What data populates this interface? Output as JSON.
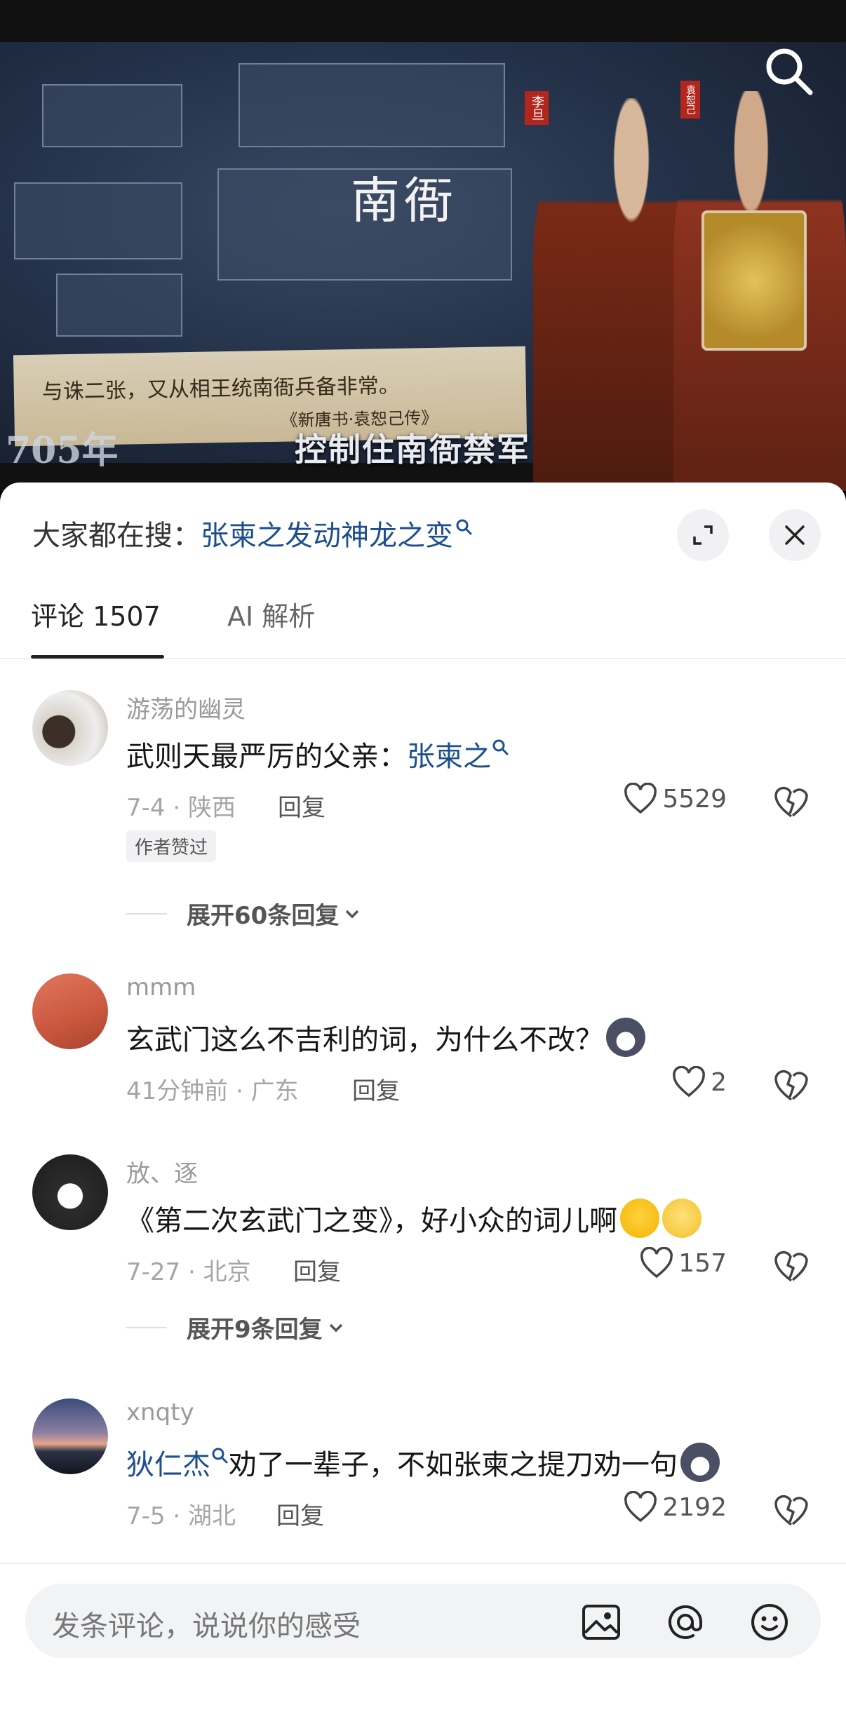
{
  "video": {
    "place_title": "南衙",
    "quote": "与诛二张，又从相王统南衙兵备非常。",
    "quote_source": "《新唐书·袁恕己传》",
    "name_tag_left": "李旦",
    "name_tag_right": "袁恕己",
    "year": "705年",
    "caption": "控制住南衙禁军"
  },
  "trending": {
    "prefix": "大家都在搜：",
    "link": "张柬之发动神龙之变"
  },
  "tabs": [
    {
      "label": "评论 1507",
      "active": true
    },
    {
      "label": "AI 解析",
      "active": false
    }
  ],
  "comments": [
    {
      "user": "游荡的幽灵",
      "text": "武则天最严厉的父亲：",
      "link": "张柬之",
      "meta": "7-4 · 陕西",
      "reply": "回复",
      "likes": "5529",
      "badge": "作者赞过",
      "expand": "展开60条回复"
    },
    {
      "user": "mmm",
      "text": "玄武门这么不吉利的词，为什么不改？",
      "meta": "41分钟前 · 广东",
      "reply": "回复",
      "likes": "2"
    },
    {
      "user": "放、逐",
      "text": "《第二次玄武门之变》，好小众的词儿啊",
      "meta": "7-27 · 北京",
      "reply": "回复",
      "likes": "157",
      "expand": "展开9条回复"
    },
    {
      "user": "xnqty",
      "link": "狄仁杰",
      "text": "劝了一辈子，不如张柬之提刀劝一句",
      "meta": "7-5 · 湖北",
      "reply": "回复",
      "likes": "2192"
    }
  ],
  "input": {
    "placeholder": "发条评论，说说你的感受"
  },
  "colors": {
    "link": "#1d4f8f",
    "sheet_bg": "#ffffff",
    "input_bg": "#f2f3f5"
  }
}
